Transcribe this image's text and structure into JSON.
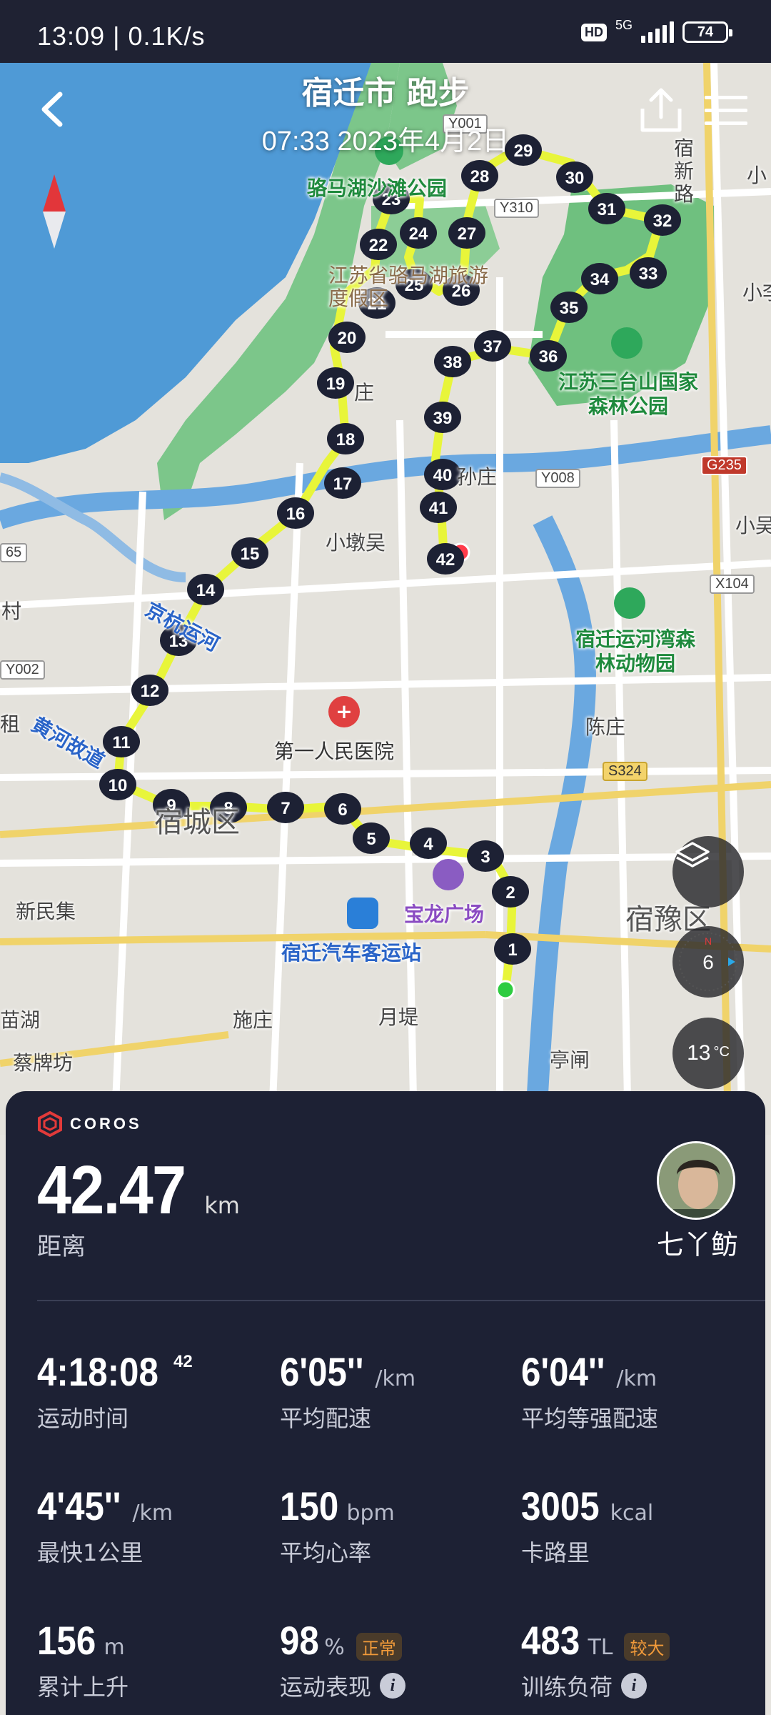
{
  "status_bar": {
    "time_speed": "13:09 | 0.1K/s",
    "hd": "HD",
    "network": "5G",
    "battery": "74"
  },
  "header": {
    "title": "宿迁市 跑步",
    "subtitle": "07:33 2023年4月2日"
  },
  "map": {
    "labels": {
      "park1": "骆马湖沙滩公园",
      "resort": "江苏省骆马湖旅游度假区",
      "forest_park": "江苏三台山国家森林公园",
      "sun_zhuang": "孙庄",
      "xiaodunwu": "小墩吴",
      "jinghang": "京杭运河",
      "yellow_river": "黄河故道",
      "hospital": "第一人民医院",
      "zoo": "宿迁运河湾森林动物园",
      "chenzhuang": "陈庄",
      "baolong": "宝龙广场",
      "bus_station": "宿迁汽车客运站",
      "suyu": "宿豫区",
      "sucheng": "宿城区",
      "xinminji": "新民集",
      "shizhuang": "施庄",
      "yuedi": "月堤",
      "tingzha": "亭闸",
      "caipaifang": "蔡牌坊",
      "suxin_road": "宿新路",
      "xiao_1": "小",
      "xiao_2": "小李",
      "xiaoyu": "小吴",
      "cun": "村",
      "ju": "租",
      "nan": "苗湖",
      "yizhuang": "庄",
      "bsixty": "65"
    },
    "road_tags": {
      "y001": "Y001",
      "y310": "Y310",
      "y008": "Y008",
      "g235": "G235",
      "x104": "X104",
      "y002": "Y002",
      "s324": "S324"
    },
    "temperature": "13",
    "temperature_unit": "°C",
    "heading": "6",
    "compass_n": "N"
  },
  "stats": {
    "brand": "COROS",
    "distance": "42.47",
    "distance_unit": "km",
    "distance_label": "距离",
    "username": "七丫鲂",
    "items": [
      {
        "value": "4:18:08",
        "sup": "42",
        "unit": "",
        "label": "运动时间"
      },
      {
        "value": "6'05''",
        "unit": "/km",
        "label": "平均配速"
      },
      {
        "value": "6'04''",
        "unit": "/km",
        "label": "平均等强配速"
      },
      {
        "value": "4'45''",
        "unit": "/km",
        "label": "最快1公里"
      },
      {
        "value": "150",
        "unit": "bpm",
        "label": "平均心率"
      },
      {
        "value": "3005",
        "unit": "kcal",
        "label": "卡路里"
      },
      {
        "value": "156",
        "unit": "m",
        "label": "累计上升"
      },
      {
        "value": "98",
        "unit": "%",
        "badge": "正常",
        "label": "运动表现"
      },
      {
        "value": "483",
        "unit": "TL",
        "badge": "较大",
        "label": "训练负荷"
      }
    ]
  },
  "route_markers": [
    "1",
    "2",
    "3",
    "4",
    "5",
    "6",
    "7",
    "8",
    "9",
    "10",
    "11",
    "12",
    "13",
    "14",
    "15",
    "16",
    "17",
    "18",
    "19",
    "20",
    "21",
    "22",
    "23",
    "24",
    "25",
    "26",
    "27",
    "28",
    "29",
    "30",
    "31",
    "32",
    "33",
    "34",
    "35",
    "36",
    "37",
    "38",
    "39",
    "40",
    "41",
    "42"
  ],
  "colors": {
    "lake": "#4f9ad6",
    "park": "#64b874",
    "route": "#e8f53a",
    "card": "#1d2134",
    "badge": "#f29b3a"
  }
}
